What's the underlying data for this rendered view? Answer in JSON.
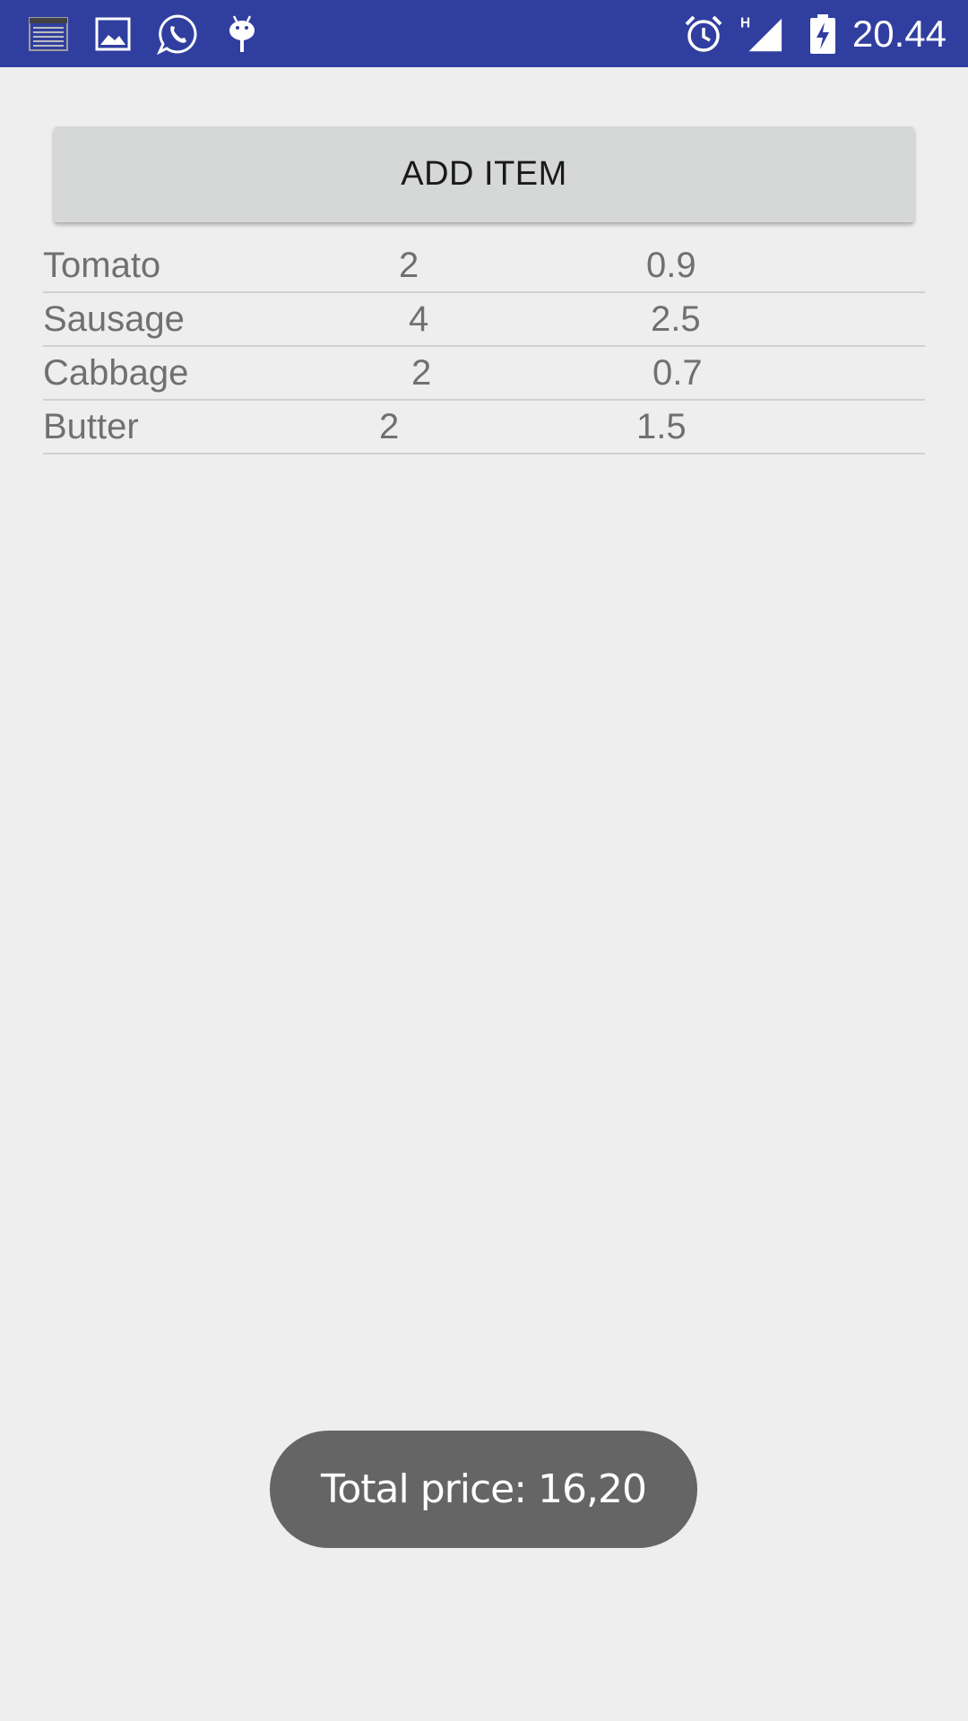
{
  "status_bar": {
    "time": "20.44",
    "network_type": "H",
    "background_color": "#303f9f",
    "left_icons": [
      "news-icon",
      "gallery-icon",
      "whatsapp-icon",
      "android-debug-icon"
    ],
    "right_icons": [
      "alarm-icon",
      "signal-icon",
      "battery-charging-icon"
    ]
  },
  "main": {
    "add_button_label": "ADD ITEM",
    "items": [
      {
        "name": "Tomato",
        "quantity": "2",
        "price": "0.9"
      },
      {
        "name": "Sausage",
        "quantity": "4",
        "price": "2.5"
      },
      {
        "name": "Cabbage",
        "quantity": "2",
        "price": "0.7"
      },
      {
        "name": "Butter",
        "quantity": "2",
        "price": "1.5"
      }
    ]
  },
  "toast": {
    "text": "Total price: 16,20"
  }
}
